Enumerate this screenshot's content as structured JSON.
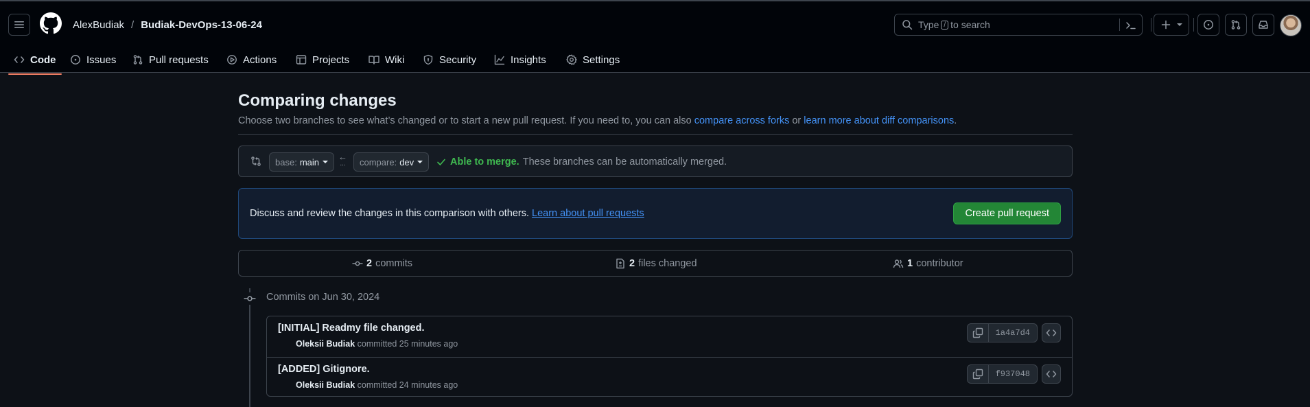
{
  "header": {
    "owner": "AlexBudiak",
    "separator": "/",
    "repo": "Budiak-DevOps-13-06-24",
    "search_prefix": "Type",
    "search_key": "/",
    "search_suffix": "to search",
    "icons": [
      "hamburger-icon",
      "github-logo",
      "search-icon",
      "terminal-icon",
      "plus-icon",
      "caret-down-icon",
      "issue-icon",
      "pull-request-icon",
      "inbox-icon",
      "avatar"
    ]
  },
  "tabs": [
    {
      "label": "Code",
      "icon": "code-icon",
      "active": true
    },
    {
      "label": "Issues",
      "icon": "issue-icon"
    },
    {
      "label": "Pull requests",
      "icon": "pull-request-icon"
    },
    {
      "label": "Actions",
      "icon": "play-icon"
    },
    {
      "label": "Projects",
      "icon": "table-icon"
    },
    {
      "label": "Wiki",
      "icon": "book-icon"
    },
    {
      "label": "Security",
      "icon": "shield-icon"
    },
    {
      "label": "Insights",
      "icon": "graph-icon"
    },
    {
      "label": "Settings",
      "icon": "gear-icon"
    }
  ],
  "compare": {
    "title": "Comparing changes",
    "desc_prefix": "Choose two branches to see what’s changed or to start a new pull request. If you need to, you can also ",
    "link_forks": "compare across forks",
    "desc_or": " or ",
    "link_learn_diff": "learn more about diff comparisons",
    "desc_end": ".",
    "base_label": "base:",
    "base_value": "main",
    "compare_label": "compare:",
    "compare_value": "dev",
    "arrow": "←",
    "dots": "...",
    "merge_ok": "Able to merge.",
    "merge_text": "These branches can be automatically merged."
  },
  "flash": {
    "text": "Discuss and review the changes in this comparison with others.",
    "link": "Learn about pull requests",
    "button": "Create pull request"
  },
  "stats": {
    "commits_count": "2",
    "commits_label": "commits",
    "files_count": "2",
    "files_label": "files changed",
    "contributors_count": "1",
    "contributors_label": "contributor"
  },
  "timeline": {
    "date_heading": "Commits on Jun 30, 2024",
    "commits": [
      {
        "title": "[INITIAL] Readmy file changed.",
        "author": "Oleksii Budiak",
        "action": "committed",
        "time": "25 minutes ago",
        "sha": "1a4a7d4"
      },
      {
        "title": "[ADDED] Gitignore.",
        "author": "Oleksii Budiak",
        "action": "committed",
        "time": "24 minutes ago",
        "sha": "f937048"
      }
    ]
  },
  "colors": {
    "accent": "#4493f8",
    "success": "#3fb950",
    "button_green": "#238636",
    "tab_underline": "#f78166"
  }
}
